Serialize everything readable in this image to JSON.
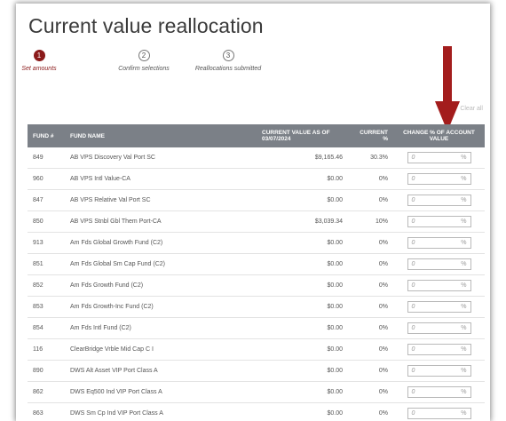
{
  "page": {
    "title": "Current value reallocation",
    "clear_all": "Clear all"
  },
  "steps": [
    {
      "number": "1",
      "label": "Set amounts",
      "active": true
    },
    {
      "number": "2",
      "label": "Confirm selections",
      "active": false
    },
    {
      "number": "3",
      "label": "Reallocations submitted",
      "active": false
    }
  ],
  "table": {
    "headers": {
      "fund_num": "FUND #",
      "fund_name": "FUND NAME",
      "current_value": "CURRENT VALUE AS OF 03/07/2024",
      "current_pct": "CURRENT %",
      "change_pct": "CHANGE % OF ACCOUNT VALUE"
    },
    "rows": [
      {
        "fund": "849",
        "name": "AB VPS Discovery Val Port SC",
        "value": "$9,165.46",
        "pct": "30.3%",
        "change": "0",
        "unit": "%"
      },
      {
        "fund": "960",
        "name": "AB VPS Intl Value-CA",
        "value": "$0.00",
        "pct": "0%",
        "change": "0",
        "unit": "%"
      },
      {
        "fund": "847",
        "name": "AB VPS Relative Val Port SC",
        "value": "$0.00",
        "pct": "0%",
        "change": "0",
        "unit": "%"
      },
      {
        "fund": "850",
        "name": "AB VPS Stnbl Gbl Them Port-CA",
        "value": "$3,039.34",
        "pct": "10%",
        "change": "0",
        "unit": "%"
      },
      {
        "fund": "913",
        "name": "Am Fds Global Growth Fund (C2)",
        "value": "$0.00",
        "pct": "0%",
        "change": "0",
        "unit": "%"
      },
      {
        "fund": "851",
        "name": "Am Fds Global Sm Cap Fund (C2)",
        "value": "$0.00",
        "pct": "0%",
        "change": "0",
        "unit": "%"
      },
      {
        "fund": "852",
        "name": "Am Fds Growth Fund (C2)",
        "value": "$0.00",
        "pct": "0%",
        "change": "0",
        "unit": "%"
      },
      {
        "fund": "853",
        "name": "Am Fds Growth-Inc Fund (C2)",
        "value": "$0.00",
        "pct": "0%",
        "change": "0",
        "unit": "%"
      },
      {
        "fund": "854",
        "name": "Am Fds Intl Fund (C2)",
        "value": "$0.00",
        "pct": "0%",
        "change": "0",
        "unit": "%"
      },
      {
        "fund": "116",
        "name": "ClearBridge Vrble Mid Cap C I",
        "value": "$0.00",
        "pct": "0%",
        "change": "0",
        "unit": "%"
      },
      {
        "fund": "890",
        "name": "DWS Alt Asset VIP Port Class A",
        "value": "$0.00",
        "pct": "0%",
        "change": "0",
        "unit": "%"
      },
      {
        "fund": "862",
        "name": "DWS Eq500 Ind VIP Port Class A",
        "value": "$0.00",
        "pct": "0%",
        "change": "0",
        "unit": "%"
      },
      {
        "fund": "863",
        "name": "DWS Sm Cp Ind VIP Port Class A",
        "value": "$0.00",
        "pct": "0%",
        "change": "0",
        "unit": "%"
      }
    ]
  },
  "colors": {
    "accent": "#8b1a1a",
    "header_bg": "#7b8087",
    "arrow": "#a31d1d"
  },
  "icons": {
    "annotation": "down-arrow-icon"
  }
}
